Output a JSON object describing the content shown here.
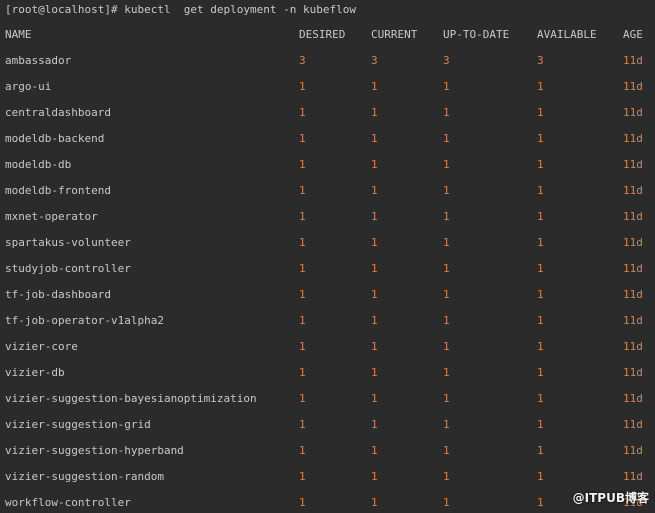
{
  "terminal": {
    "prompt": "[root@localhost]# kubectl  get deployment -n kubeflow",
    "columns": {
      "name": "NAME",
      "desired": "DESIRED",
      "current": "CURRENT",
      "uptodate": "UP-TO-DATE",
      "available": "AVAILABLE",
      "age": "AGE"
    },
    "rows": [
      {
        "name": "ambassador",
        "desired": "3",
        "current": "3",
        "uptodate": "3",
        "available": "3",
        "age": "11d"
      },
      {
        "name": "argo-ui",
        "desired": "1",
        "current": "1",
        "uptodate": "1",
        "available": "1",
        "age": "11d"
      },
      {
        "name": "centraldashboard",
        "desired": "1",
        "current": "1",
        "uptodate": "1",
        "available": "1",
        "age": "11d"
      },
      {
        "name": "modeldb-backend",
        "desired": "1",
        "current": "1",
        "uptodate": "1",
        "available": "1",
        "age": "11d"
      },
      {
        "name": "modeldb-db",
        "desired": "1",
        "current": "1",
        "uptodate": "1",
        "available": "1",
        "age": "11d"
      },
      {
        "name": "modeldb-frontend",
        "desired": "1",
        "current": "1",
        "uptodate": "1",
        "available": "1",
        "age": "11d"
      },
      {
        "name": "mxnet-operator",
        "desired": "1",
        "current": "1",
        "uptodate": "1",
        "available": "1",
        "age": "11d"
      },
      {
        "name": "spartakus-volunteer",
        "desired": "1",
        "current": "1",
        "uptodate": "1",
        "available": "1",
        "age": "11d"
      },
      {
        "name": "studyjob-controller",
        "desired": "1",
        "current": "1",
        "uptodate": "1",
        "available": "1",
        "age": "11d"
      },
      {
        "name": "tf-job-dashboard",
        "desired": "1",
        "current": "1",
        "uptodate": "1",
        "available": "1",
        "age": "11d"
      },
      {
        "name": "tf-job-operator-v1alpha2",
        "desired": "1",
        "current": "1",
        "uptodate": "1",
        "available": "1",
        "age": "11d"
      },
      {
        "name": "vizier-core",
        "desired": "1",
        "current": "1",
        "uptodate": "1",
        "available": "1",
        "age": "11d"
      },
      {
        "name": "vizier-db",
        "desired": "1",
        "current": "1",
        "uptodate": "1",
        "available": "1",
        "age": "11d"
      },
      {
        "name": "vizier-suggestion-bayesianoptimization",
        "desired": "1",
        "current": "1",
        "uptodate": "1",
        "available": "1",
        "age": "11d"
      },
      {
        "name": "vizier-suggestion-grid",
        "desired": "1",
        "current": "1",
        "uptodate": "1",
        "available": "1",
        "age": "11d"
      },
      {
        "name": "vizier-suggestion-hyperband",
        "desired": "1",
        "current": "1",
        "uptodate": "1",
        "available": "1",
        "age": "11d"
      },
      {
        "name": "vizier-suggestion-random",
        "desired": "1",
        "current": "1",
        "uptodate": "1",
        "available": "1",
        "age": "11d"
      },
      {
        "name": "workflow-controller",
        "desired": "1",
        "current": "1",
        "uptodate": "1",
        "available": "1",
        "age": "11d"
      }
    ]
  },
  "watermark": {
    "text": "@ITPUB博客"
  },
  "colors": {
    "background": "#2b2b2b",
    "text": "#c8c8c8",
    "number": "#d8834a"
  }
}
